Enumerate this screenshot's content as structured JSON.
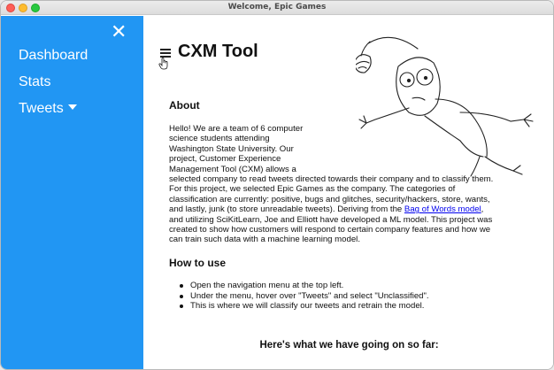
{
  "window": {
    "title": "Welcome, Epic Games"
  },
  "sidebar": {
    "close_glyph": "✕",
    "items": [
      {
        "label": "Dashboard"
      },
      {
        "label": "Stats"
      },
      {
        "label": "Tweets"
      }
    ]
  },
  "main": {
    "title": "CXM Tool",
    "about": {
      "heading": "About",
      "lines": [
        "Hello! We are a team of 6 computer",
        "science students attending",
        "Washington State University. Our",
        "project, Customer Experience",
        "Management Tool (CXM) allows a",
        "selected company to read tweets directed towards their company and to classify them.",
        "For this project, we selected Epic Games as the company. The categories of",
        "classification are currently: positive, bugs and glitches, security/hackers, store, wants,",
        "and lastly, junk (to store unreadable tweets). Deriving from the "
      ],
      "link_text": "Bag of Words model",
      "link_suffix": ",",
      "lines_after": [
        "and utilizing SciKitLearn, Joe and Elliott have developed a ML model. This project was",
        "created to show how customers will respond to certain company features and how we",
        "can train such data with a machine learning model."
      ]
    },
    "howto": {
      "heading": "How to use",
      "items": [
        "Open the navigation menu at the top left.",
        "Under the menu, hover over \"Tweets\" and select \"Unclassified\".",
        "This is where we will classify our tweets and retrain the model."
      ]
    },
    "footer_heading": "Here's what we have going on so far:"
  },
  "colors": {
    "sidebar": "#2196f3",
    "link": "#0000ee"
  },
  "icons": [
    "close-icon",
    "caret-down-icon",
    "hamburger-menu-icon",
    "mouse-pointer-icon"
  ]
}
